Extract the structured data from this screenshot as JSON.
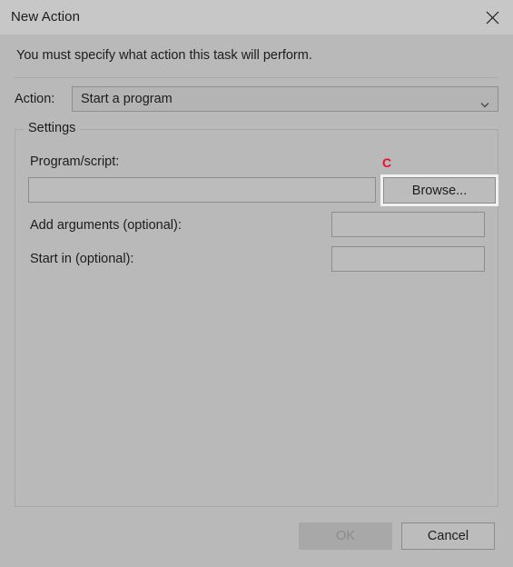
{
  "window": {
    "title": "New Action",
    "close_icon": "close-icon"
  },
  "instruction": "You must specify what action this task will perform.",
  "action_row": {
    "label": "Action:",
    "selected_value": "Start a program",
    "chevron_icon": "chevron-down-icon",
    "options": [
      "Start a program"
    ]
  },
  "settings": {
    "legend": "Settings",
    "program": {
      "label": "Program/script:",
      "value": "",
      "placeholder": ""
    },
    "browse_button": {
      "label": "Browse...",
      "focused": true
    },
    "annotation": {
      "letter": "C",
      "color": "#e8112d"
    },
    "add_arguments": {
      "label": "Add arguments (optional):",
      "value": "",
      "placeholder": ""
    },
    "start_in": {
      "label": "Start in (optional):",
      "value": "",
      "placeholder": ""
    }
  },
  "footer": {
    "ok_label": "OK",
    "ok_enabled": false,
    "cancel_label": "Cancel",
    "cancel_enabled": true
  },
  "colors": {
    "dialog_background": "#b9b9b9",
    "titlebar_background": "#c7c7c7",
    "field_background": "#bcbcbc",
    "field_border": "#8d8d8d",
    "text": "#1c1c1c",
    "disabled_text": "#8b8b8b",
    "accent_annotation": "#e8112d"
  }
}
